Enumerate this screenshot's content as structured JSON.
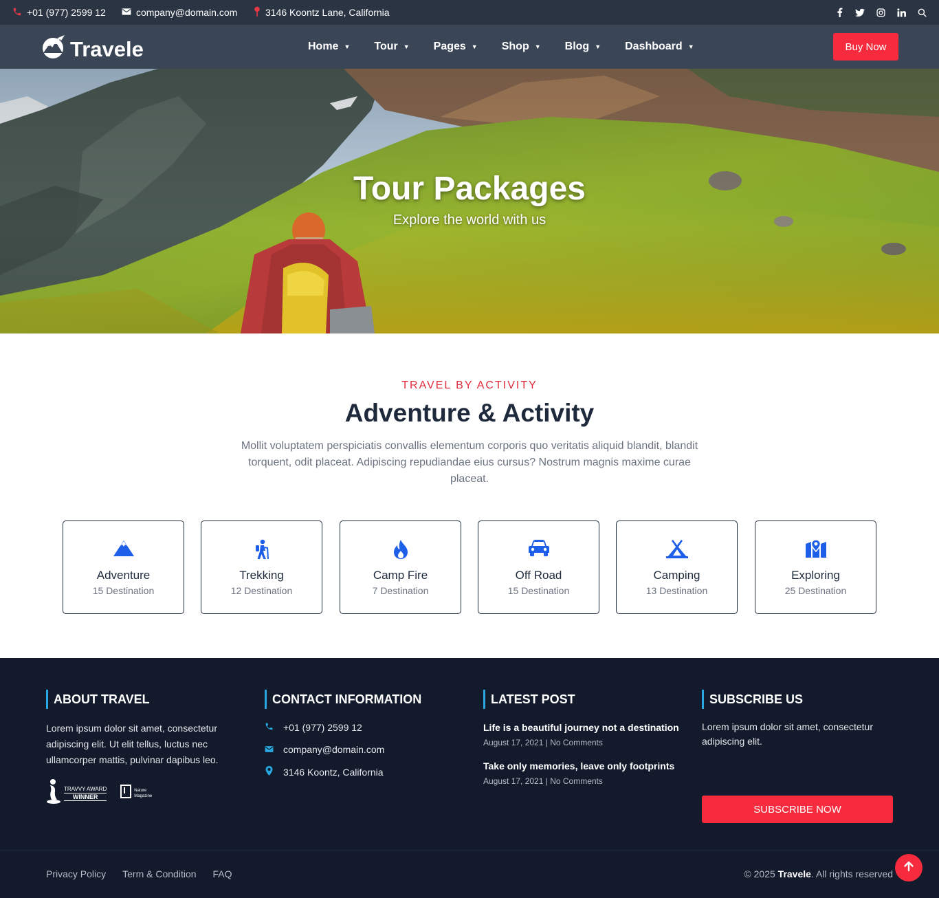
{
  "topbar": {
    "phone": "+01 (977) 2599 12",
    "email": "company@domain.com",
    "address": "3146 Koontz Lane, California",
    "social_icons": [
      "facebook-icon",
      "twitter-icon",
      "instagram-icon",
      "linkedin-icon",
      "search-icon"
    ]
  },
  "nav": {
    "brand": "Travele",
    "menu": [
      {
        "label": "Home"
      },
      {
        "label": "Tour"
      },
      {
        "label": "Pages"
      },
      {
        "label": "Shop"
      },
      {
        "label": "Blog"
      },
      {
        "label": "Dashboard"
      }
    ],
    "cta": "Buy Now"
  },
  "hero": {
    "title": "Tour Packages",
    "subtitle": "Explore the world with us"
  },
  "activity": {
    "eyebrow": "TRAVEL BY ACTIVITY",
    "title": "Adventure & Activity",
    "description": "Mollit voluptatem perspiciatis convallis elementum corporis quo veritatis aliquid blandit, blandit torquent, odit placeat. Adipiscing repudiandae eius cursus? Nostrum magnis maxime curae placeat.",
    "items": [
      {
        "name": "Adventure",
        "count": "15 Destination",
        "icon": "mountain-icon"
      },
      {
        "name": "Trekking",
        "count": "12 Destination",
        "icon": "hiker-icon"
      },
      {
        "name": "Camp Fire",
        "count": "7 Destination",
        "icon": "fire-icon"
      },
      {
        "name": "Off Road",
        "count": "15 Destination",
        "icon": "car-icon"
      },
      {
        "name": "Camping",
        "count": "13 Destination",
        "icon": "tent-icon"
      },
      {
        "name": "Exploring",
        "count": "25 Destination",
        "icon": "map-pin-icon"
      }
    ]
  },
  "footer": {
    "about": {
      "heading": "ABOUT TRAVEL",
      "text": "Lorem ipsum dolor sit amet, consectetur adipiscing elit. Ut elit tellus, luctus nec ullamcorper mattis, pulvinar dapibus leo.",
      "award1_line1": "TRAVVY AWARD",
      "award1_line2": "WINNER",
      "award2_line1": "Nature",
      "award2_line2": "Magazine"
    },
    "contact": {
      "heading": "CONTACT INFORMATION",
      "phone": "+01 (977) 2599 12",
      "email": "company@domain.com",
      "address": "3146 Koontz, California"
    },
    "latest": {
      "heading": "LATEST POST",
      "posts": [
        {
          "title": "Life is a beautiful journey not a destination",
          "date": "August 17, 2021",
          "comments": "No Comments"
        },
        {
          "title": "Take only memories, leave only footprints",
          "date": "August 17, 2021",
          "comments": "No Comments"
        }
      ]
    },
    "subscribe": {
      "heading": "SUBSCRIBE US",
      "text": "Lorem ipsum dolor sit amet, consectetur adipiscing elit.",
      "button": "SUBSCRIBE NOW"
    },
    "links": [
      "Privacy Policy",
      "Term & Condition",
      "FAQ"
    ],
    "copyright_prefix": "© 2025",
    "copyright_brand": "Travele",
    "copyright_suffix": ". All rights reserved"
  },
  "colors": {
    "accent": "#f62b3d",
    "icon_blue": "#1d5fe9",
    "footer_bg": "#121a2b",
    "heading_bar": "#2aa7e0"
  }
}
